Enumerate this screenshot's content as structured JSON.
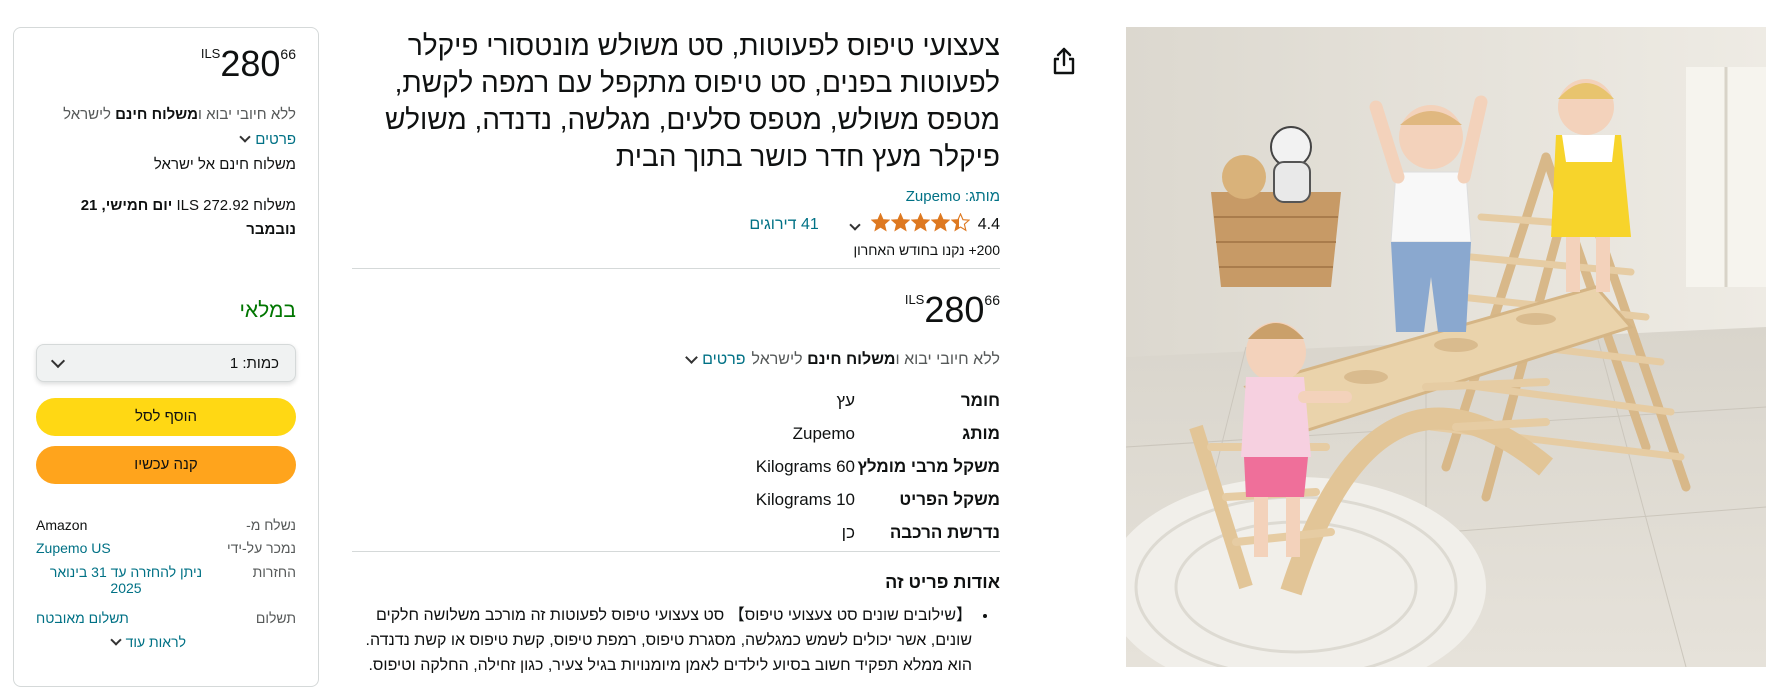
{
  "buybox": {
    "price": {
      "currency": "ILS",
      "whole": "280",
      "fraction": "66"
    },
    "import_prefix": "ללא חיובי יבוא ו",
    "import_bold": "משלוח חינם",
    "import_suffix": " לישראל",
    "details_link": "פרטים",
    "free_shipping": "משלוח חינם אל ישראל",
    "delivery_prefix": "משלוח ILS 272.92 ",
    "delivery_bold": "יום חמישי, 21 נובמבר",
    "stock": "במלאי",
    "quantity_label": "כמות:",
    "quantity_value": "1",
    "add_to_cart": "הוסף לסל",
    "buy_now": "קנה עכשיו",
    "ships_from_label": "נשלח מ-",
    "ships_from_value": "Amazon",
    "sold_by_label": "נמכר על-ידי",
    "sold_by_value": "Zupemo US",
    "returns_label": "החזרות",
    "returns_value": "ניתן להחזרה עד 31 בינואר 2025",
    "payment_label": "תשלום",
    "payment_value": "תשלום מאובטח",
    "see_more": "לראות עוד"
  },
  "product": {
    "title": "צעצועי טיפוס לפעוטות, סט משולש מונטסורי פיקלר לפעוטות בפנים, סט טיפוס מתקפל עם רמפה לקשת, מטפס משולש, מטפס סלעים, מגלשה, נדנדה, משולש פיקלר מעץ חדר כושר בתוך הבית",
    "brand_link": "מותג: Zupemo",
    "rating": "4.4",
    "rating_stars": 4.4,
    "ratings_count": "41 דירוגים",
    "bought": "200+ נקנו בחודש האחרון",
    "price": {
      "currency": "ILS",
      "whole": "280",
      "fraction": "66"
    },
    "import_prefix": "ללא חיובי יבוא ו",
    "import_bold": "משלוח חינם",
    "import_suffix": " לישראל",
    "details_link": "פרטים",
    "specs": [
      {
        "key": "חומר",
        "value": "עץ"
      },
      {
        "key": "מותג",
        "value": "Zupemo"
      },
      {
        "key": "משקל מרבי מומלץ",
        "value": "60 Kilograms"
      },
      {
        "key": "משקל הפריט",
        "value": "10 Kilograms"
      },
      {
        "key": "נדרשת הרכבה",
        "value": "כן"
      }
    ],
    "about_heading": "אודות פריט זה",
    "about_bullets": [
      "【שילובים שונים סט צעצועי טיפוס】 סט צעצועי טיפוס לפעוטות זה מורכב משלושה חלקים שונים, אשר יכולים לשמש כמגלשה, מסגרת טיפוס, רמפת טיפוס, קשת טיפוס או קשת נדנדה. הוא ממלא תפקיד חשוב בסיוע לילדים לאמן מיומנויות בגיל צעיר, כגון זחילה, החלקה וטיפוס."
    ]
  },
  "colors": {
    "link": "#007185",
    "in_stock": "#007600",
    "add_to_cart": "#FFD814",
    "buy_now": "#FFA41C",
    "star": "#DE7921"
  },
  "icons": {
    "share": "share-icon",
    "dropdown": "chevron-down-icon",
    "star": "star-icon"
  }
}
